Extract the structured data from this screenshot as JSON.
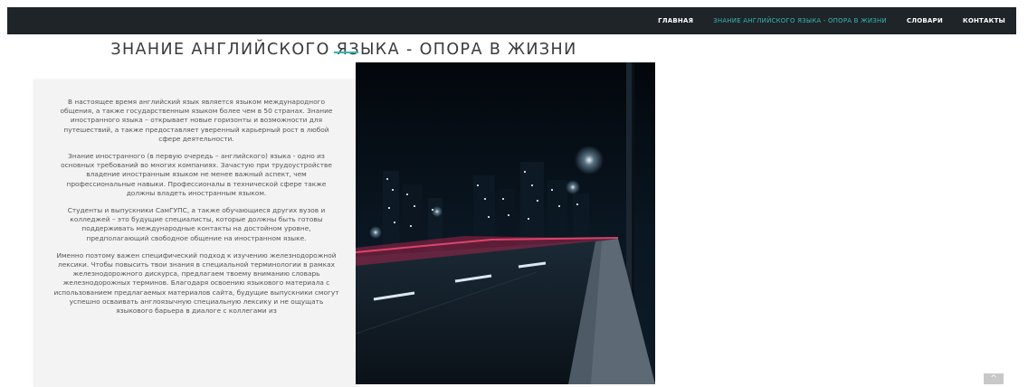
{
  "nav": {
    "items": [
      {
        "label": "ГЛАВНАЯ",
        "active": false
      },
      {
        "label": "ЗНАНИЕ АНГЛИЙСКОГО ЯЗЫКА - ОПОРА В ЖИЗНИ",
        "active": true
      },
      {
        "label": "СЛОВАРИ",
        "active": false
      },
      {
        "label": "КОНТАКТЫ",
        "active": false
      }
    ]
  },
  "page": {
    "title": "ЗНАНИЕ АНГЛИЙСКОГО ЯЗЫКА - ОПОРА В ЖИЗНИ"
  },
  "content": {
    "paragraphs": [
      "В настоящее время английский язык является языком международного общения, а также государственным языком более чем в 50 странах. Знание иностранного языка – открывает новые горизонты и возможности для путешествий, а также предоставляет уверенный карьерный рост в любой сфере деятельности.",
      "Знание иностранного (в первую очередь – английского) языка - одно из основных требований во многих компаниях. Зачастую при трудоустройстве владение иностранным языком не менее важный аспект, чем профессиональные навыки. Профессионалы в технической сфере также должны владеть иностранным языком.",
      "Студенты и выпускники СамГУПС, а также обучающиеся других вузов и колледжей – это будущие специалисты, которые должны быть готовы поддерживать международные контакты на достойном уровне, предполагающий свободное общение на иностранном языке.",
      "Именно поэтому важен специфический подход к изучению железнодорожной лексики. Чтобы повысить твои знания в специальной терминологии в рамках железнодорожного дискурса, предлагаем твоему вниманию словарь железнодорожных терминов. Благодаря освоению языкового материала с использованием предлагаемых материалов сайта, будущие выпускники смогут успешно осваивать англоязычную специальную лексику и не ощущать языкового барьера в диалоге с коллегами из"
    ]
  },
  "photo": {
    "subject": "night-city-road-photo"
  },
  "scroll_top": {
    "label": "^"
  },
  "colors": {
    "nav_bg": "#1f2429",
    "accent": "#35b7b0",
    "card_bg": "#f3f3f3"
  }
}
